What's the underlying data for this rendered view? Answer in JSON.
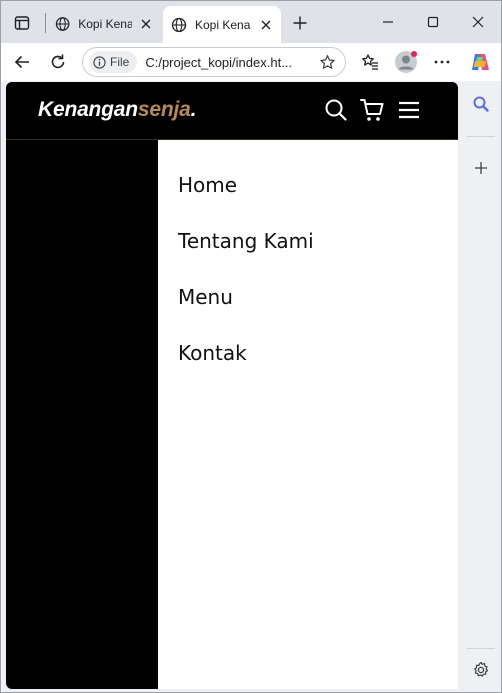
{
  "browser": {
    "tabs": [
      {
        "title": "Kopi Kenar",
        "icon": "globe-icon",
        "active": false
      },
      {
        "title": "Kopi Kenar",
        "icon": "globe-icon",
        "active": true
      }
    ],
    "address": {
      "scheme_label": "File",
      "url": "C:/project_kopi/index.ht..."
    }
  },
  "site": {
    "logo_main": "Kenangan",
    "logo_accent": "senja",
    "logo_dot": ".",
    "accent_color": "#b6895b",
    "menu": [
      {
        "label": "Home"
      },
      {
        "label": "Tentang Kami"
      },
      {
        "label": "Menu"
      },
      {
        "label": "Kontak"
      }
    ]
  }
}
